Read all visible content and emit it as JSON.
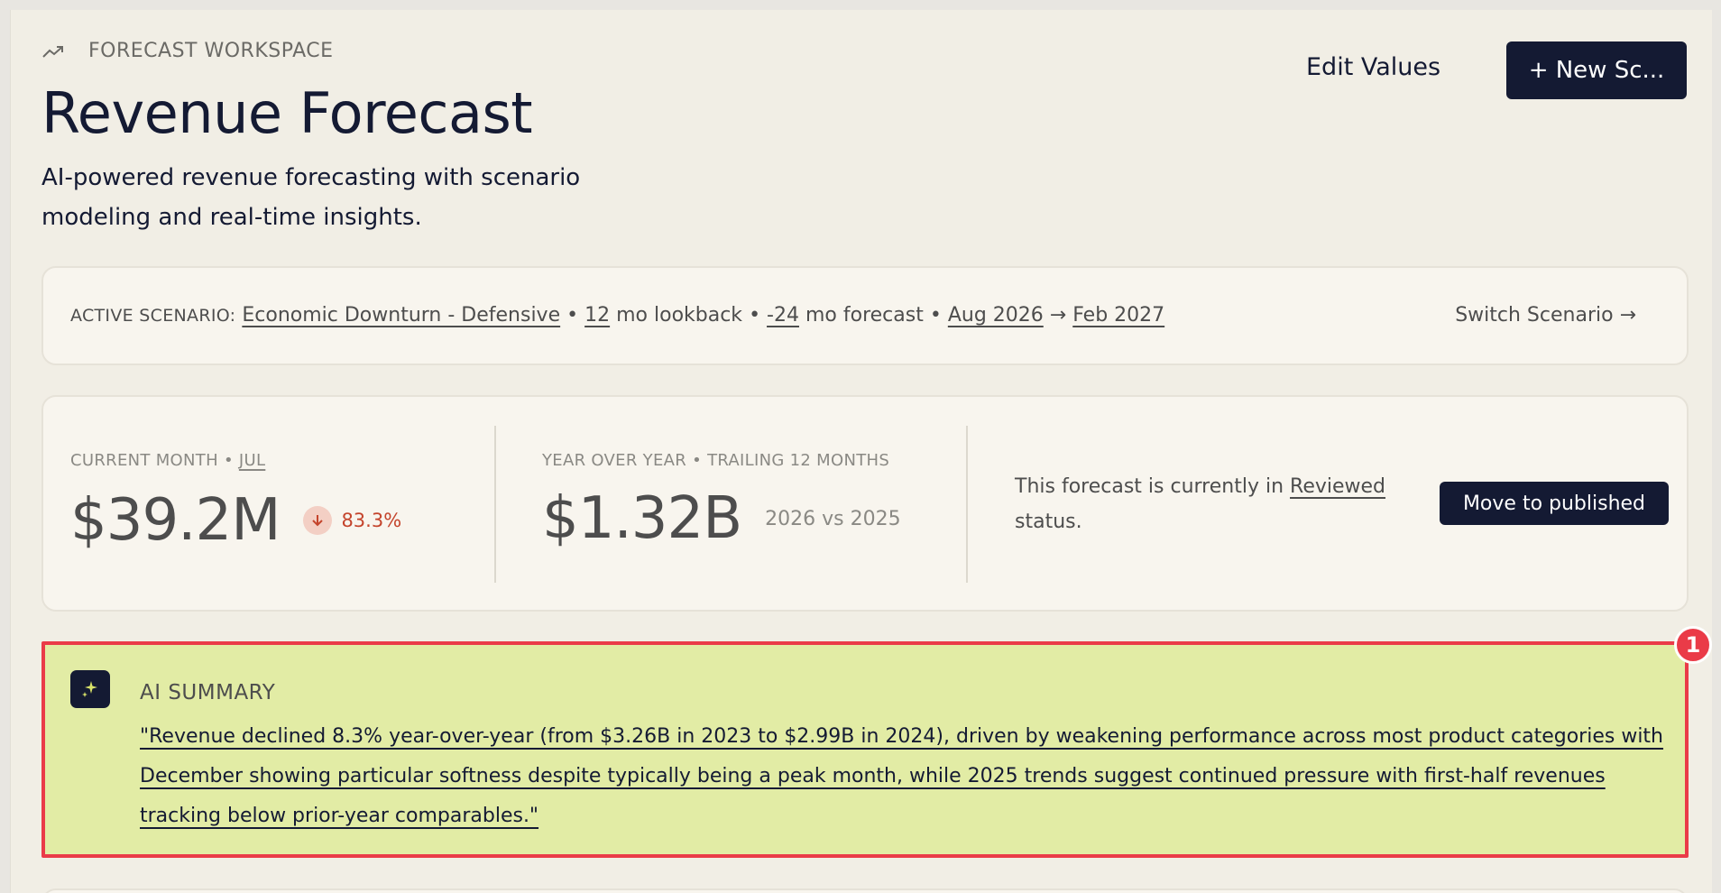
{
  "header": {
    "eyebrow": "FORECAST WORKSPACE",
    "eyebrow_icon": "trend-up-icon",
    "title": "Revenue Forecast",
    "subtitle": "AI-powered revenue forecasting with scenario modeling and real-time insights.",
    "edit_values_label": "Edit Values",
    "new_scenario_label": "+ New Sc..."
  },
  "scenario": {
    "label": "ACTIVE SCENARIO:",
    "name": "Economic Downturn - Defensive",
    "sep": "•",
    "lookback_value": "12",
    "lookback_suffix": "mo lookback",
    "forecast_value": "-24",
    "forecast_suffix": "mo forecast",
    "start": "Aug 2026",
    "arrow": "→",
    "end": "Feb 2027",
    "switch_label": "Switch Scenario →"
  },
  "metrics": {
    "current": {
      "label": "CURRENT MONTH",
      "month": "JUL",
      "value": "$39.2M",
      "delta": "83.3%",
      "delta_direction": "down"
    },
    "yoy": {
      "label": "YEAR OVER YEAR",
      "label2": "TRAILING 12 MONTHS",
      "value": "$1.32B",
      "comparison": "2026 vs 2025"
    },
    "status": {
      "text_before": "This forecast is currently in",
      "status": "Reviewed",
      "text_after": "status.",
      "button_label": "Move to published"
    }
  },
  "ai_summary": {
    "label": "AI SUMMARY",
    "icon": "sparkle-icon",
    "text": "\"Revenue declined 8.3% year-over-year (from $3.26B in 2023 to $2.99B in 2024), driven by weakening performance across most product categories with December showing particular softness despite typically being a peak month, while 2025 trends suggest continued pressure with first-half revenues tracking below prior-year comparables.\"",
    "badge": "1"
  },
  "colors": {
    "navy": "#141a33",
    "highlight": "#e2eca5",
    "annotation_red": "#ea3b48",
    "delta_red": "#c4442c"
  }
}
